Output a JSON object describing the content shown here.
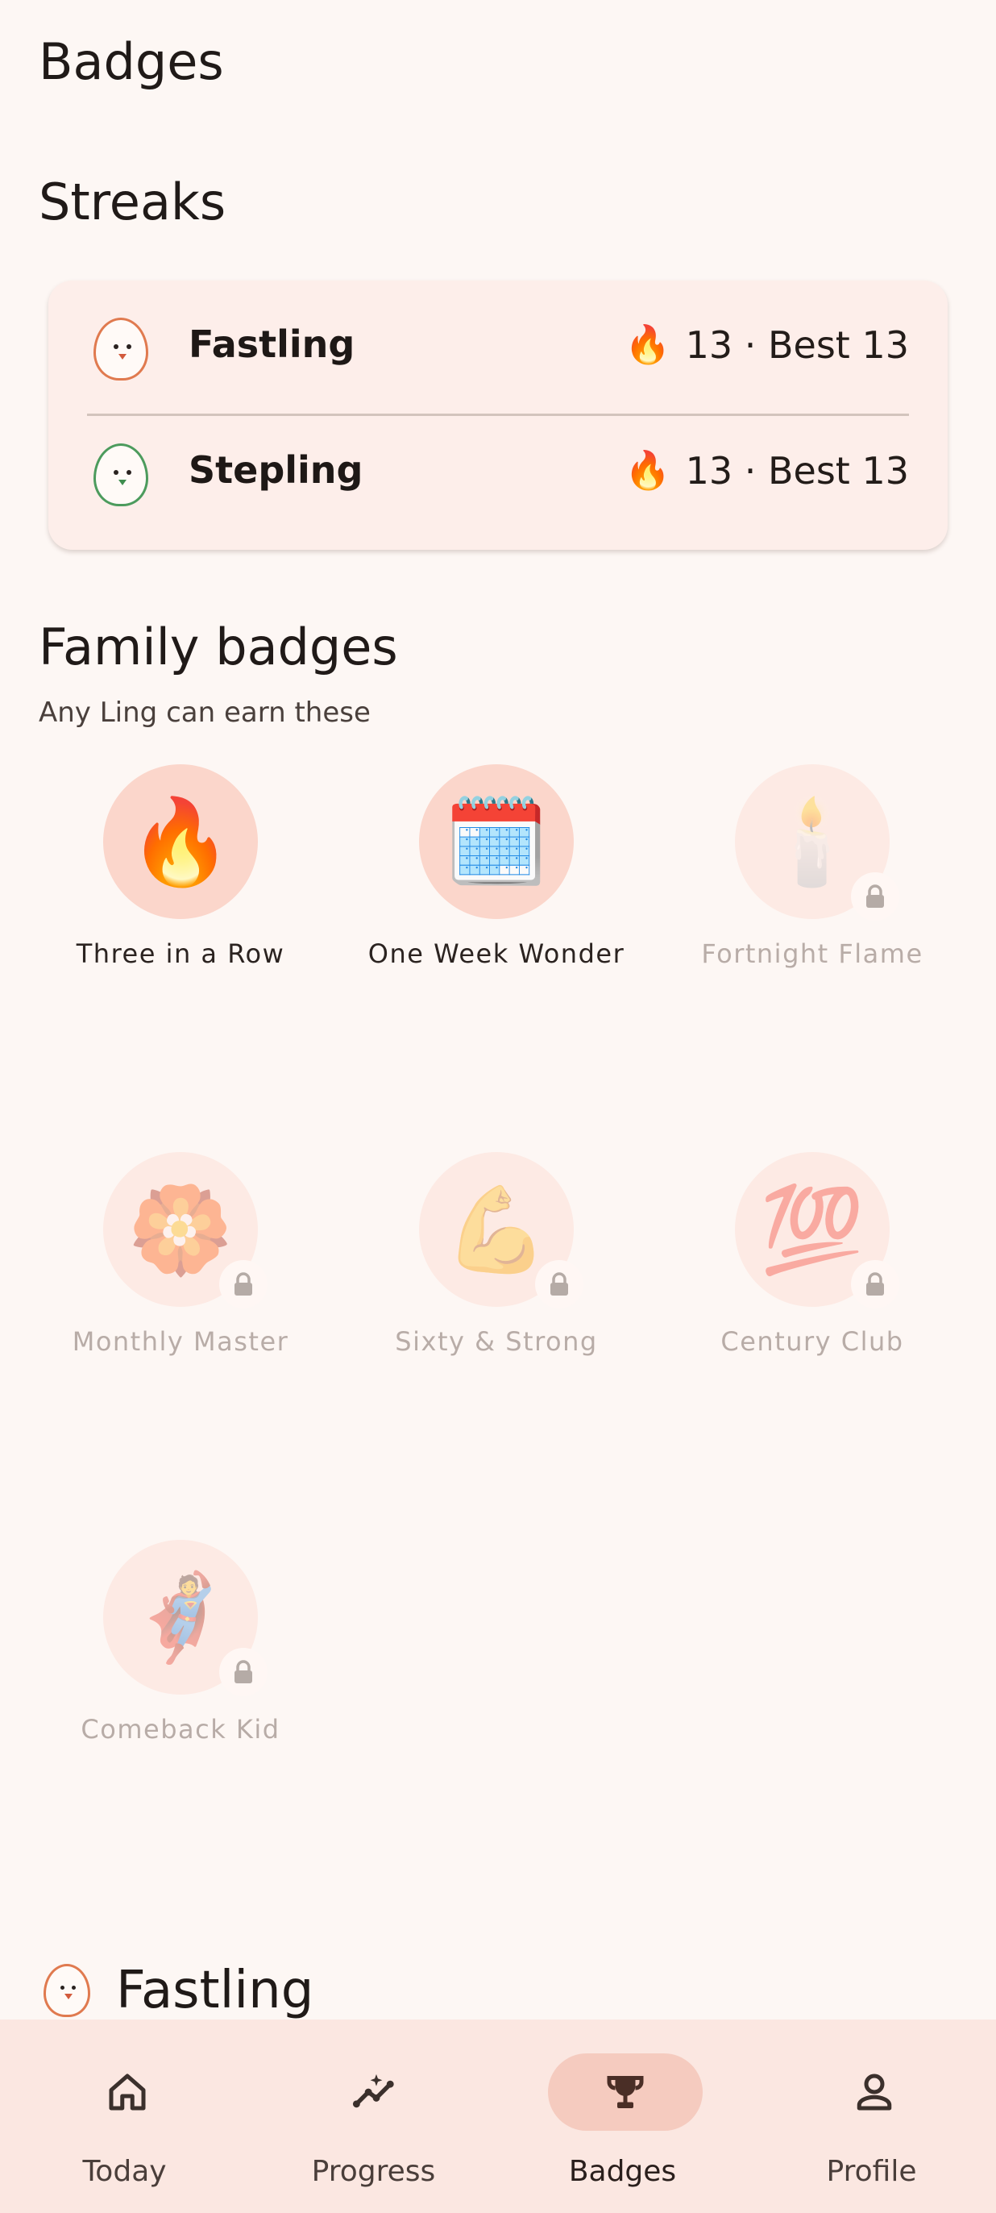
{
  "page": {
    "title": "Badges"
  },
  "streaks": {
    "title": "Streaks",
    "items": [
      {
        "name": "Fastling",
        "icon": "fire-icon",
        "stat": "13 · Best 13",
        "color": "#e07a4f"
      },
      {
        "name": "Stepling",
        "icon": "fire-icon",
        "stat": "13 · Best 13",
        "color": "#4c9b5d"
      }
    ],
    "flame_glyph": "🔥"
  },
  "family_badges": {
    "title": "Family badges",
    "subtitle": "Any Ling can earn these",
    "badges": [
      {
        "label": "Three in a Row",
        "emoji": "🔥",
        "locked": false
      },
      {
        "label": "One Week Wonder",
        "emoji": "🗓️",
        "locked": false
      },
      {
        "label": "Fortnight Flame",
        "emoji": "🕯️",
        "locked": true
      },
      {
        "label": "Monthly Master",
        "emoji": "🏵️",
        "locked": true
      },
      {
        "label": "Sixty & Strong",
        "emoji": "💪",
        "locked": true
      },
      {
        "label": "Century Club",
        "emoji": "💯",
        "locked": true
      },
      {
        "label": "Comeback Kid",
        "emoji": "🦸",
        "locked": true
      }
    ]
  },
  "ling_section": {
    "name": "Fastling"
  },
  "nav": {
    "items": [
      {
        "label": "Today",
        "icon": "home-icon",
        "active": false
      },
      {
        "label": "Progress",
        "icon": "sparkle-chart-icon",
        "active": false
      },
      {
        "label": "Badges",
        "icon": "trophy-icon",
        "active": true
      },
      {
        "label": "Profile",
        "icon": "person-icon",
        "active": false
      }
    ]
  },
  "colors": {
    "background": "#fdf7f4",
    "accent": "#f5cbbf",
    "earned_badge": "#fbd6cb",
    "locked_badge": "#fdeae4"
  }
}
